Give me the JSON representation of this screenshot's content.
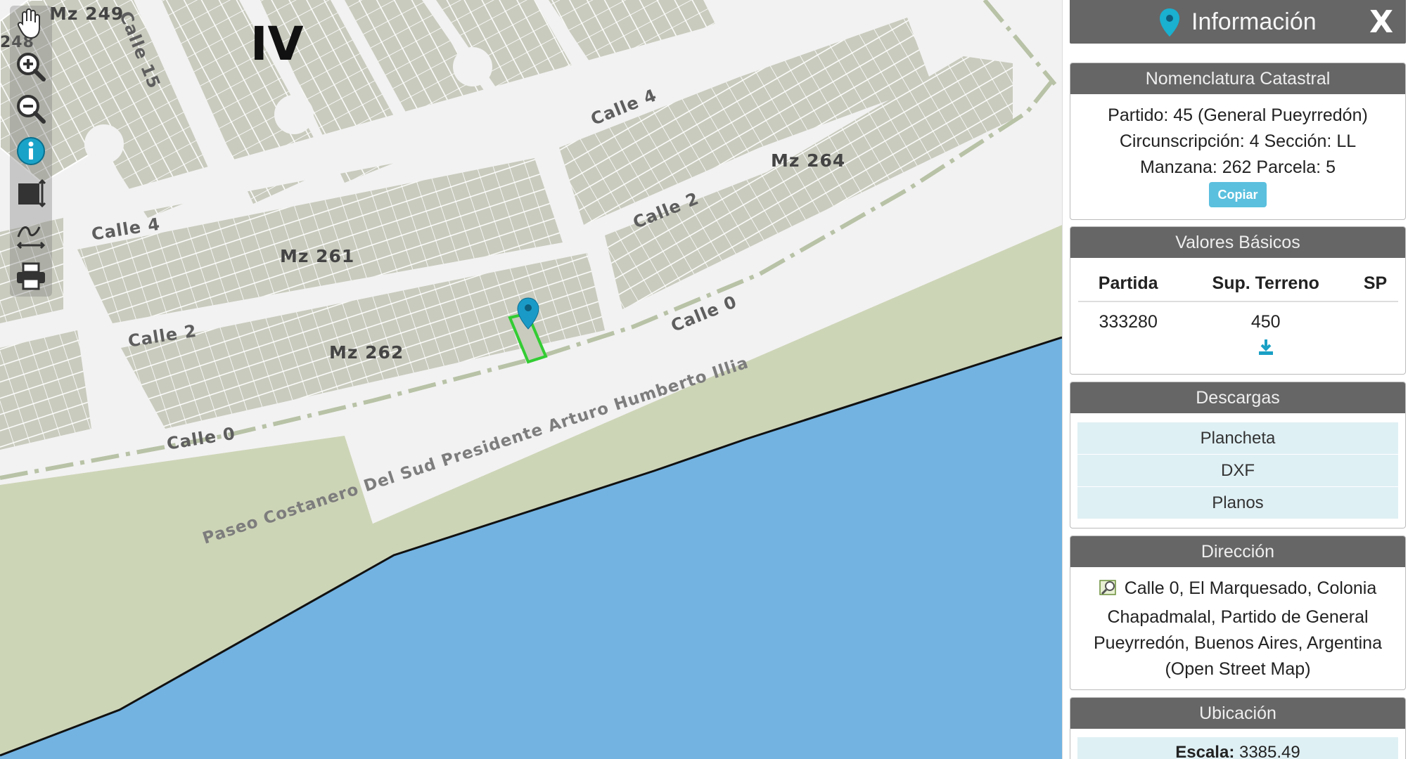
{
  "map": {
    "sector_label": "IV",
    "blocks": [
      "Mz 249",
      "Mz 261",
      "Mz 262",
      "Mz 264"
    ],
    "block_partial": "248",
    "streets": [
      "Calle 15",
      "Calle 4",
      "Calle 4",
      "Calle 2",
      "Calle 2",
      "Calle 0",
      "Calle 0"
    ],
    "avenue": "Paseo Costanero Del Sud Presidente Arturo Humberto Illia",
    "colors": {
      "parcel": "#c9cbbe",
      "parcel_line": "#ffffff",
      "road": "#f2f2f2",
      "beach": "#cdd5b7",
      "water": "#72b3e2",
      "selected": "#33cc33",
      "marker": "#1a9bc7"
    }
  },
  "toolbar": {
    "tools": [
      "pan-hand-icon",
      "zoom-in-icon",
      "zoom-out-icon",
      "info-icon",
      "full-extent-icon",
      "measure-icon",
      "print-icon"
    ]
  },
  "panel": {
    "title": "Información",
    "close_label": "X",
    "nomenclatura": {
      "header": "Nomenclatura Catastral",
      "line1": "Partido: 45 (General Pueyrredón)",
      "line2": "Circunscripción: 4 Sección: LL",
      "line3": "Manzana: 262 Parcela: 5",
      "copy_label": "Copiar"
    },
    "valores": {
      "header": "Valores Básicos",
      "columns": [
        "Partida",
        "Sup. Terreno",
        "SP"
      ],
      "row": [
        "333280",
        "450",
        ""
      ]
    },
    "descargas": {
      "header": "Descargas",
      "items": [
        "Plancheta",
        "DXF",
        "Planos"
      ]
    },
    "direccion": {
      "header": "Dirección",
      "text": "Calle 0, El Marquesado, Colonia Chapadmalal, Partido de General Pueyrredón, Buenos Aires, Argentina (Open Street Map)"
    },
    "ubicacion": {
      "header": "Ubicación",
      "scale_label": "Escala:",
      "scale_value": "3385.49"
    }
  }
}
